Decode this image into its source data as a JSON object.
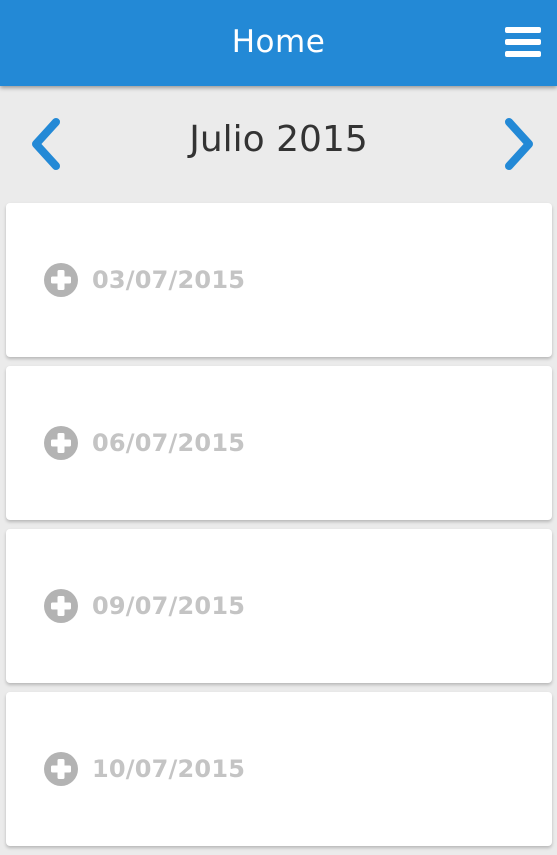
{
  "header": {
    "title": "Home",
    "menu_icon": "hamburger-menu-icon",
    "background_color": "#2389d6"
  },
  "calendar": {
    "month_label": "Julio 2015",
    "prev_icon": "chevron-left-icon",
    "next_icon": "chevron-right-icon",
    "arrow_color": "#2389d6"
  },
  "entries": [
    {
      "date": "03/07/2015",
      "icon": "plus-circle-icon"
    },
    {
      "date": "06/07/2015",
      "icon": "plus-circle-icon"
    },
    {
      "date": "09/07/2015",
      "icon": "plus-circle-icon"
    },
    {
      "date": "10/07/2015",
      "icon": "plus-circle-icon"
    }
  ]
}
